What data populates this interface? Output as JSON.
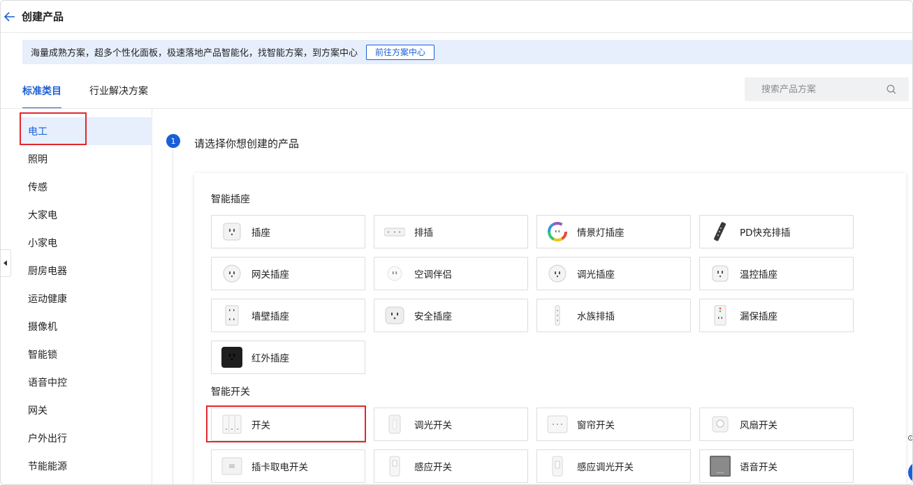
{
  "header": {
    "title": "创建产品"
  },
  "banner": {
    "text": "海量成熟方案，超多个性化面板，极速落地产品智能化，找智能方案，到方案中心",
    "button_label": "前往方案中心"
  },
  "tabs": [
    {
      "label": "标准类目",
      "active": true
    },
    {
      "label": "行业解决方案",
      "active": false
    }
  ],
  "search": {
    "placeholder": "搜索产品方案"
  },
  "sidebar": {
    "items": [
      {
        "label": "电工",
        "active": true
      },
      {
        "label": "照明"
      },
      {
        "label": "传感"
      },
      {
        "label": "大家电"
      },
      {
        "label": "小家电"
      },
      {
        "label": "厨房电器"
      },
      {
        "label": "运动健康"
      },
      {
        "label": "摄像机"
      },
      {
        "label": "智能锁"
      },
      {
        "label": "语音中控"
      },
      {
        "label": "网关"
      },
      {
        "label": "户外出行"
      },
      {
        "label": "节能能源"
      }
    ]
  },
  "step": {
    "number": "1",
    "title": "请选择你想创建的产品"
  },
  "groups": [
    {
      "title": "智能插座",
      "items": [
        {
          "label": "插座",
          "icon": "socket-icon"
        },
        {
          "label": "排插",
          "icon": "power-strip-icon"
        },
        {
          "label": "情景灯插座",
          "icon": "rgb-ring-icon"
        },
        {
          "label": "PD快充排插",
          "icon": "pd-strip-icon"
        },
        {
          "label": "网关插座",
          "icon": "round-socket-icon"
        },
        {
          "label": "空调伴侣",
          "icon": "ac-companion-icon"
        },
        {
          "label": "调光插座",
          "icon": "dimmer-socket-icon"
        },
        {
          "label": "温控插座",
          "icon": "thermo-socket-icon"
        },
        {
          "label": "墙壁插座",
          "icon": "wall-socket-icon"
        },
        {
          "label": "安全插座",
          "icon": "safe-socket-icon"
        },
        {
          "label": "水族排插",
          "icon": "aqua-strip-icon"
        },
        {
          "label": "漏保插座",
          "icon": "leak-socket-icon"
        },
        {
          "label": "红外插座",
          "icon": "ir-socket-icon"
        }
      ]
    },
    {
      "title": "智能开关",
      "items": [
        {
          "label": "开关",
          "icon": "switch-icon"
        },
        {
          "label": "调光开关",
          "icon": "dimmer-switch-icon"
        },
        {
          "label": "窗帘开关",
          "icon": "curtain-switch-icon"
        },
        {
          "label": "风扇开关",
          "icon": "fan-switch-icon"
        },
        {
          "label": "插卡取电开关",
          "icon": "card-switch-icon"
        },
        {
          "label": "感应开关",
          "icon": "sensor-switch-icon"
        },
        {
          "label": "感应调光开关",
          "icon": "sensor-dimmer-icon"
        },
        {
          "label": "语音开关",
          "icon": "voice-switch-icon"
        }
      ]
    }
  ],
  "colors": {
    "accent": "#1a5fd8",
    "highlight_box": "#e0282e",
    "banner_bg": "#e7effc"
  }
}
